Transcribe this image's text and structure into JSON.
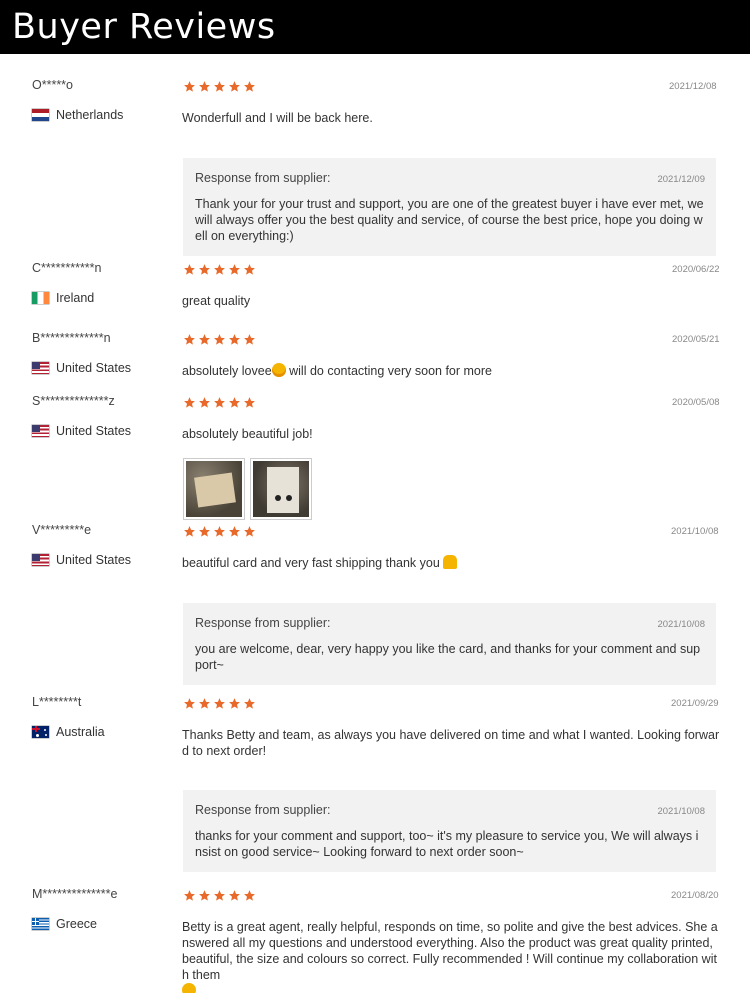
{
  "header": {
    "title": "Buyer Reviews"
  },
  "response_label": "Response from supplier:",
  "colors": {
    "star": "#e8692a",
    "header_bg": "#000000",
    "response_bg": "#f2f2f2"
  },
  "reviews": [
    {
      "buyer": "O*****o",
      "country": "Netherlands",
      "flag": "netherlands-flag",
      "rating": 5,
      "date": "2021/12/08",
      "comment": "Wonderfull and I will be back here.",
      "response": {
        "date": "2021/12/09",
        "text": "Thank your for your trust and support, you are one of the greatest buyer i have ever met, we will always offer you the best quality and service, of course the best price, hope you doing well on everything:)"
      }
    },
    {
      "buyer": "C***********n",
      "country": "Ireland",
      "flag": "ireland-flag",
      "rating": 5,
      "date": "2020/06/22",
      "comment": "great quality"
    },
    {
      "buyer": "B*************n",
      "country": "United States",
      "flag": "us-flag",
      "rating": 5,
      "date": "2020/05/21",
      "comment_before": "absolutely lovee",
      "comment_after": " will do contacting very soon for more",
      "emoji": "star-struck-emoji"
    },
    {
      "buyer": "S**************z",
      "country": "United States",
      "flag": "us-flag",
      "rating": 5,
      "date": "2020/05/08",
      "comment": "absolutely beautiful job!"
    },
    {
      "buyer": "V*********e",
      "country": "United States",
      "flag": "us-flag",
      "rating": 5,
      "date": "2021/10/08",
      "comment_before": "beautiful card and very fast shipping thank you ",
      "emoji": "folded-hands-emoji",
      "response": {
        "date": "2021/10/08",
        "text": "you are welcome, dear, very happy you like the card, and thanks for your comment and support~"
      }
    },
    {
      "buyer": "L********t",
      "country": "Australia",
      "flag": "australia-flag",
      "rating": 5,
      "date": "2021/09/29",
      "comment": "Thanks Betty and team, as always you have delivered on time and what I wanted. Looking forward to next order!",
      "response": {
        "date": "2021/10/08",
        "text": "thanks for your comment and support, too~ it's my pleasure to service you, We will always insist on good service~ Looking forward to next order soon~"
      }
    },
    {
      "buyer": "M**************e",
      "country": "Greece",
      "flag": "greece-flag",
      "rating": 5,
      "date": "2021/08/20",
      "comment": "Betty is a great agent, really helpful, responds on time, so polite and give the best advices. She answered all my questions and understood everything. Also the product was great quality printed, beautiful, the size and colours so correct. Fully recommended ! Will continue my collaboration with them",
      "emoji": "smiling-emoji"
    }
  ]
}
